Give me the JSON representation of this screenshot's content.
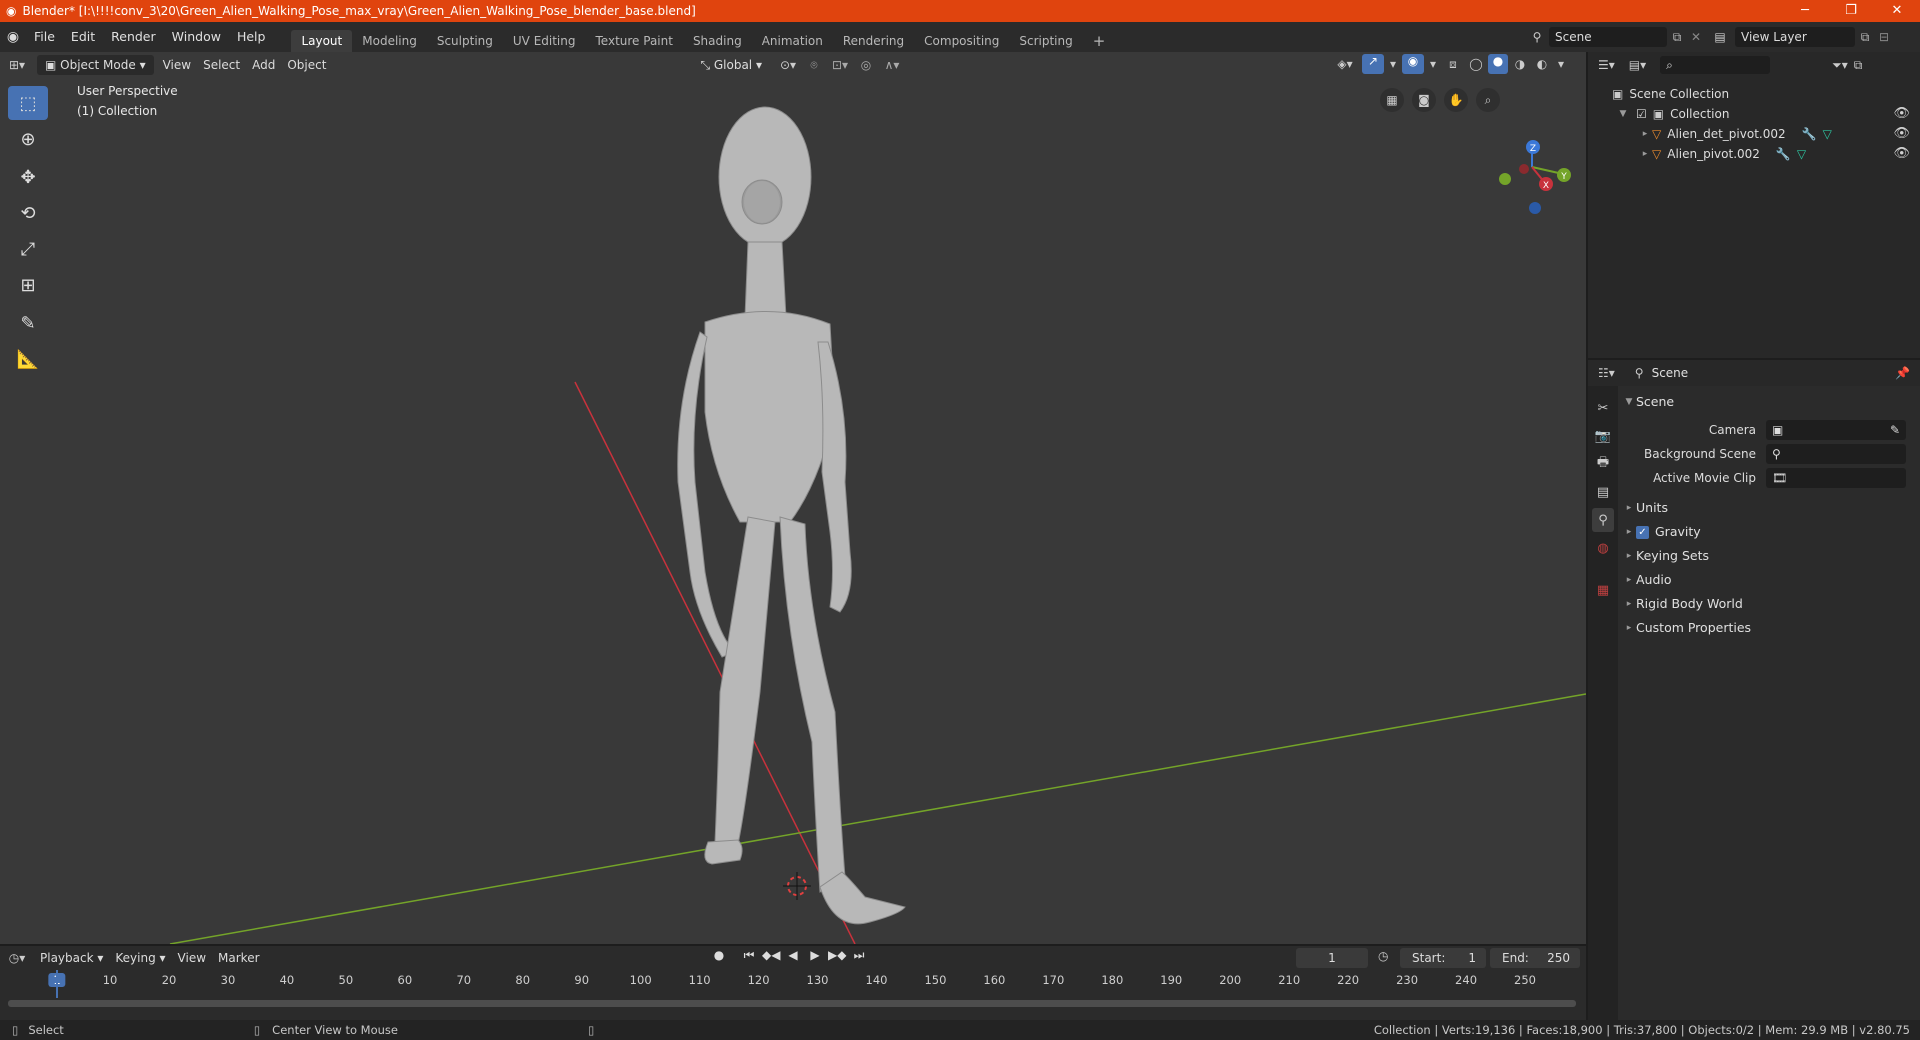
{
  "window": {
    "title": "Blender* [I:\\!!!!conv_3\\20\\Green_Alien_Walking_Pose_max_vray\\Green_Alien_Walking_Pose_blender_base.blend]",
    "minimize": "─",
    "maximize": "❐",
    "close": "✕"
  },
  "menu": [
    "File",
    "Edit",
    "Render",
    "Window",
    "Help"
  ],
  "workspaces": [
    "Layout",
    "Modeling",
    "Sculpting",
    "UV Editing",
    "Texture Paint",
    "Shading",
    "Animation",
    "Rendering",
    "Compositing",
    "Scripting"
  ],
  "scene_field": "Scene",
  "view_layer_field": "View Layer",
  "viewport": {
    "mode": "Object Mode",
    "menus": [
      "View",
      "Select",
      "Add",
      "Object"
    ],
    "orientation": "Global",
    "overlay_line1": "User Perspective",
    "overlay_line2": "(1) Collection",
    "axis_colors": {
      "x": "#c8323c",
      "y": "#74a429",
      "z": "#3b78d8"
    },
    "gizmo_labels": {
      "x": "X",
      "y": "Y",
      "z": "Z"
    }
  },
  "outliner": {
    "root": "Scene Collection",
    "collection": "Collection",
    "objects": [
      "Alien_det_pivot.002",
      "Alien_pivot.002"
    ]
  },
  "properties": {
    "header": "Scene",
    "section": "Scene",
    "fields": [
      {
        "label": "Camera"
      },
      {
        "label": "Background Scene"
      },
      {
        "label": "Active Movie Clip"
      }
    ],
    "subsections": [
      "Units",
      "Gravity",
      "Keying Sets",
      "Audio",
      "Rigid Body World",
      "Custom Properties"
    ]
  },
  "timeline": {
    "menus": [
      "Playback",
      "Keying",
      "View",
      "Marker"
    ],
    "current_frame": "1",
    "start_label": "Start:",
    "start": "1",
    "end_label": "End:",
    "end": "250",
    "ticks": [
      "1",
      "10",
      "20",
      "30",
      "40",
      "50",
      "60",
      "70",
      "80",
      "90",
      "100",
      "110",
      "120",
      "130",
      "140",
      "150",
      "160",
      "170",
      "180",
      "190",
      "200",
      "210",
      "220",
      "230",
      "240",
      "250"
    ]
  },
  "status": {
    "left_action": "Select",
    "middle_action": "Center View to Mouse",
    "stats": "Collection | Verts:19,136 | Faces:18,900 | Tris:37,800 | Objects:0/2 | Mem: 29.9 MB | v2.80.75"
  }
}
